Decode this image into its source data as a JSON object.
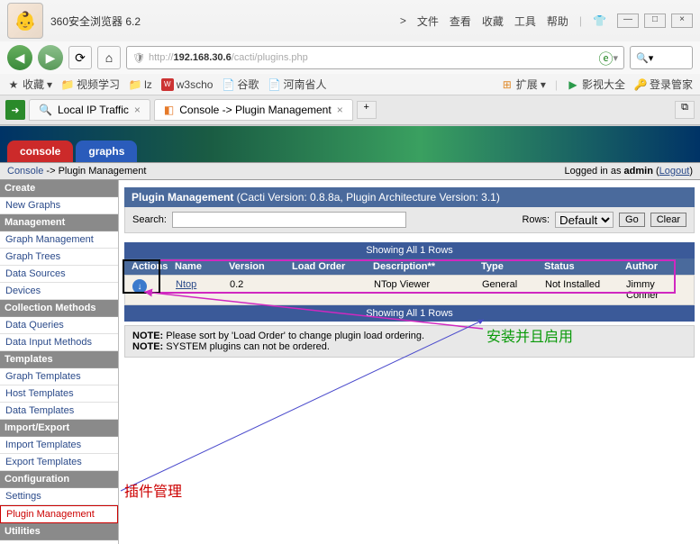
{
  "browser": {
    "title": "360安全浏览器 6.2",
    "menu": [
      "文件",
      "查看",
      "收藏",
      "工具",
      "帮助"
    ],
    "url_proto": "http://",
    "url_host": "192.168.30.6",
    "url_path": "/cacti/plugins.php",
    "bookmarks_label": "收藏",
    "bm_items": [
      "视频学习",
      "lz",
      "w3scho",
      "谷歌",
      "河南省人"
    ],
    "ext_label": "扩展",
    "movie_label": "影视大全",
    "login_label": "登录管家"
  },
  "tabs": {
    "tab1": "Local IP Traffic",
    "tab2": "Console -> Plugin Management"
  },
  "cacti": {
    "tab_console": "console",
    "tab_graphs": "graphs",
    "breadcrumb_console": "Console",
    "breadcrumb_sep": " -> ",
    "breadcrumb_page": "Plugin Management",
    "login_text": "Logged in as ",
    "login_user": "admin",
    "logout": "Logout"
  },
  "nav": {
    "create": "Create",
    "new_graphs": "New Graphs",
    "management": "Management",
    "graph_mgmt": "Graph Management",
    "graph_trees": "Graph Trees",
    "data_sources": "Data Sources",
    "devices": "Devices",
    "coll_methods": "Collection Methods",
    "data_queries": "Data Queries",
    "data_input": "Data Input Methods",
    "templates": "Templates",
    "graph_tpl": "Graph Templates",
    "host_tpl": "Host Templates",
    "data_tpl": "Data Templates",
    "import_export": "Import/Export",
    "import_tpl": "Import Templates",
    "export_tpl": "Export Templates",
    "configuration": "Configuration",
    "settings": "Settings",
    "plugin_mgmt": "Plugin Management",
    "utilities": "Utilities"
  },
  "panel": {
    "title_b": "Plugin Management",
    "title_rest": " (Cacti Version: 0.8.8a, Plugin Architecture Version: 3.1)",
    "search": "Search:",
    "rows": "Rows:",
    "rows_sel": "Default",
    "go": "Go",
    "clear": "Clear",
    "showing": "Showing All 1 Rows",
    "h_actions": "Actions",
    "h_name": "Name",
    "h_ver": "Version",
    "h_load": "Load Order",
    "h_desc": "Description**",
    "h_type": "Type",
    "h_status": "Status",
    "h_author": "Author",
    "r_name": "Ntop",
    "r_ver": "0.2",
    "r_load": "",
    "r_desc": "NTop Viewer",
    "r_type": "General",
    "r_status": "Not Installed",
    "r_author": "Jimmy Conner",
    "note1_b": "NOTE:",
    "note1": " Please sort by 'Load Order' to change plugin load ordering.",
    "note2_b": "NOTE:",
    "note2": " SYSTEM plugins can not be ordered."
  },
  "anno": {
    "a1": "安装并且启用",
    "a2": "插件管理"
  }
}
